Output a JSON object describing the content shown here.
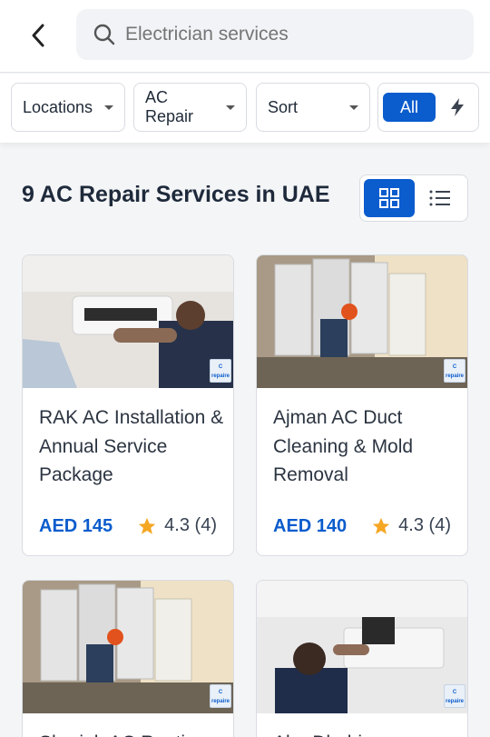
{
  "header": {
    "search_placeholder": "Electrician services",
    "back_icon": "chevron-left-icon",
    "search_icon": "search-icon"
  },
  "filters": {
    "locations_label": "Locations",
    "category_label": "AC Repair",
    "sort_label": "Sort",
    "all_label": "All",
    "bolt_icon": "bolt-icon"
  },
  "results": {
    "title": "9 AC Repair Services in UAE",
    "view_grid_icon": "grid-view-icon",
    "view_list_icon": "list-view-icon"
  },
  "cards": [
    {
      "name": "RAK AC Installation & Annual Service Package",
      "price": "AED 145",
      "rating": "4.3",
      "reviews": "(4)",
      "badge": "C\nrepaire"
    },
    {
      "name": "Ajman AC Duct Cleaning & Mold Removal",
      "price": "AED 140",
      "rating": "4.3",
      "reviews": "(4)",
      "badge": "C\nrepaire"
    },
    {
      "name": "Sharjah AC Routine",
      "price": "",
      "rating": "",
      "reviews": "",
      "badge": "C\nrepaire"
    },
    {
      "name": "Abu Dhabi",
      "price": "",
      "rating": "",
      "reviews": "",
      "badge": "C\nrepaire"
    }
  ],
  "colors": {
    "accent": "#0b5ccd",
    "star": "#f5a623",
    "title": "#1e2a3b"
  }
}
